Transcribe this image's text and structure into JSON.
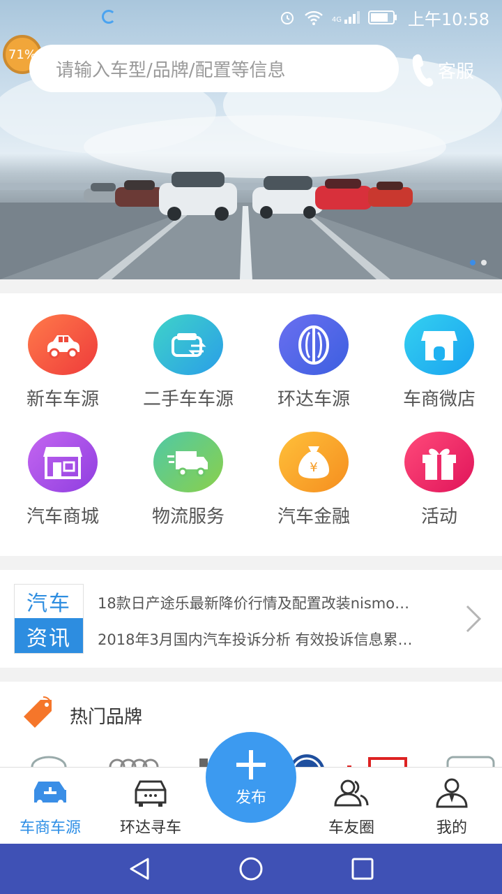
{
  "status_bar": {
    "time": "上午10:58",
    "network_label": "4G"
  },
  "battery_badge": "71%",
  "search": {
    "placeholder": "请输入车型/品牌/配置等信息"
  },
  "header": {
    "service_label": "客服"
  },
  "grid": {
    "items": [
      {
        "label": "新车车源",
        "icon": "car-icon",
        "color": "#f2533d"
      },
      {
        "label": "二手车车源",
        "icon": "car-exchange-icon",
        "color": "#33b5e5"
      },
      {
        "label": "环达车源",
        "icon": "huanda-logo-icon",
        "color": "#4966e6"
      },
      {
        "label": "车商微店",
        "icon": "store-icon",
        "color": "#1fb6f2"
      },
      {
        "label": "汽车商城",
        "icon": "shop-icon",
        "color": "#b24ee8"
      },
      {
        "label": "物流服务",
        "icon": "truck-icon",
        "color": "#7ccf52"
      },
      {
        "label": "汽车金融",
        "icon": "money-bag-icon",
        "color": "#f8a22a"
      },
      {
        "label": "活动",
        "icon": "gift-icon",
        "color": "#ef2f6b"
      }
    ]
  },
  "news": {
    "logo_top": "汽车",
    "logo_bottom": "资讯",
    "items": [
      "18款日产途乐最新降价行情及配置改装nismo…",
      "2018年3月国内汽车投诉分析 有效投诉信息累…"
    ]
  },
  "brands": {
    "title": "热门品牌"
  },
  "bottom_nav": {
    "items": [
      {
        "label": "车商车源",
        "icon": "car-source-icon",
        "active": true
      },
      {
        "label": "环达寻车",
        "icon": "car-search-icon",
        "active": false
      },
      {
        "label": "车友圈",
        "icon": "friends-icon",
        "active": false
      },
      {
        "label": "我的",
        "icon": "profile-icon",
        "active": false
      }
    ],
    "publish_label": "发布"
  },
  "colors": {
    "accent": "#2f8fe6",
    "system_nav": "#3f51b5"
  }
}
